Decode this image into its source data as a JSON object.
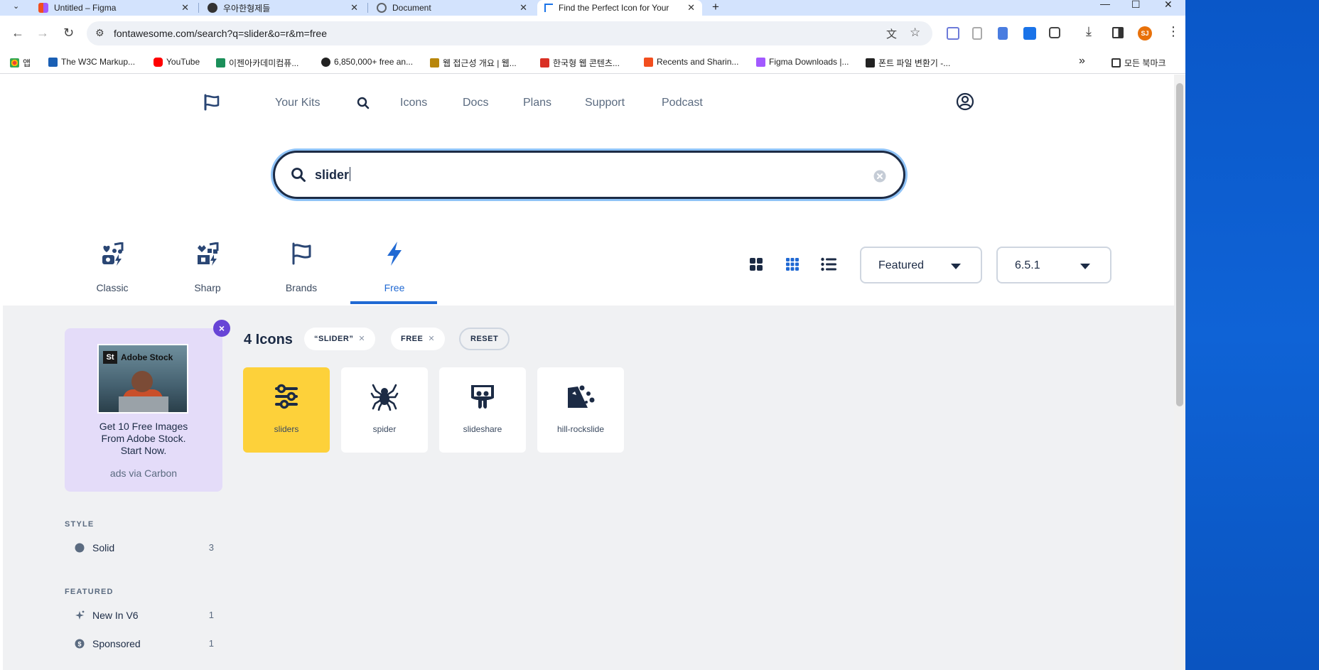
{
  "browser": {
    "tabs": [
      {
        "title": "Untitled – Figma",
        "color": "#a259ff"
      },
      {
        "title": "우아한형제들",
        "color": "#333333"
      },
      {
        "title": "Document",
        "color": "#5f6368"
      },
      {
        "title": "Find the Perfect Icon for Your",
        "color": "#1a73e8"
      }
    ],
    "new_tab": "+",
    "url": "fontawesome.com/search?q=slider&o=r&m=free",
    "profile_initials": "SJ",
    "bookmarks": [
      {
        "label": "앱",
        "color": "#ea4335"
      },
      {
        "label": "The W3C Markup...",
        "color": "#1a5fb4"
      },
      {
        "label": "YouTube",
        "color": "#ff0000"
      },
      {
        "label": "이젠아카데미컴퓨...",
        "color": "#1b8f5a"
      },
      {
        "label": "6,850,000+ free an...",
        "color": "#222222"
      },
      {
        "label": "웹 접근성 개요 | 웹...",
        "color": "#b8860b"
      },
      {
        "label": "한국형 웹 콘텐츠...",
        "color": "#d93025"
      },
      {
        "label": "Recents and Sharin...",
        "color": "#f24e1e"
      },
      {
        "label": "Figma Downloads |...",
        "color": "#a259ff"
      },
      {
        "label": "폰트 파일 변환기 -...",
        "color": "#222222"
      }
    ],
    "bookmarks_more": "»",
    "all_bookmarks": "모든 북마크"
  },
  "nav": {
    "items": [
      "Your Kits",
      "Icons",
      "Docs",
      "Plans",
      "Support",
      "Podcast"
    ]
  },
  "search": {
    "value": "slider"
  },
  "families": [
    {
      "label": "Classic"
    },
    {
      "label": "Sharp"
    },
    {
      "label": "Brands"
    },
    {
      "label": "Free"
    }
  ],
  "controls": {
    "sort": "Featured",
    "version": "6.5.1"
  },
  "ad": {
    "brand": "Adobe Stock",
    "brand_mark": "St",
    "text": "Get 10 Free Images From Adobe Stock. Start Now.",
    "via": "ads via Carbon"
  },
  "results": {
    "count_label": "4 Icons",
    "chips": [
      "“SLIDER”",
      "FREE"
    ],
    "reset": "RESET",
    "icons": [
      "sliders",
      "spider",
      "slideshare",
      "hill-rockslide"
    ]
  },
  "sidebar": {
    "style_heading": "STYLE",
    "style_items": [
      {
        "label": "Solid",
        "count": "3"
      }
    ],
    "featured_heading": "FEATURED",
    "featured_items": [
      {
        "label": "New In V6",
        "count": "1"
      },
      {
        "label": "Sponsored",
        "count": "1"
      }
    ]
  },
  "colors": {
    "accent_blue": "#2069d3",
    "navy": "#1c2b45",
    "selected_yellow": "#fdd13a",
    "ad_purple": "#6744d6"
  }
}
